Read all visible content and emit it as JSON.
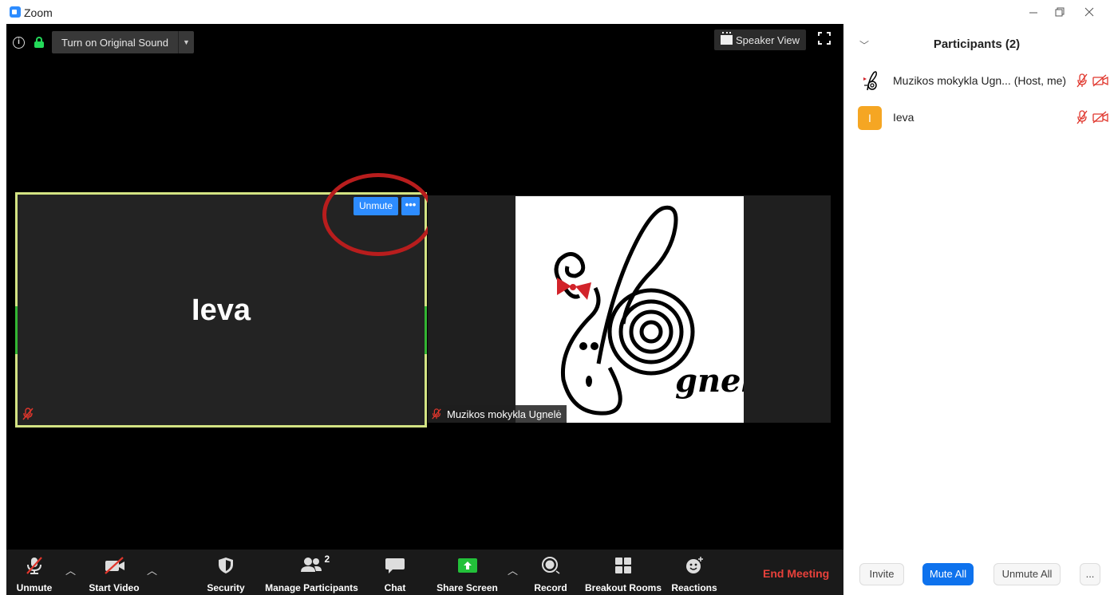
{
  "window": {
    "title": "Zoom",
    "controls": [
      "minimize-icon",
      "restore-icon",
      "close-icon"
    ]
  },
  "meeting": {
    "original_sound_label": "Turn on Original Sound",
    "speaker_view_label": "Speaker View",
    "tiles": [
      {
        "name": "Ieva",
        "muted": true,
        "active_speaker_border": "#d3e383"
      },
      {
        "name": "Muzikos mokykla Ugnelė",
        "muted": true
      }
    ],
    "tile_actions": {
      "unmute_label": "Unmute",
      "more_label": "•••"
    },
    "logo": {
      "text": "gnelė",
      "bow_color": "#d2232a"
    }
  },
  "toolbar": {
    "unmute": "Unmute",
    "start_video": "Start Video",
    "security": "Security",
    "manage_participants": "Manage Participants",
    "participant_count": "2",
    "chat": "Chat",
    "share_screen": "Share Screen",
    "record": "Record",
    "breakout_rooms": "Breakout Rooms",
    "reactions": "Reactions",
    "end_meeting": "End Meeting"
  },
  "participants_panel": {
    "title": "Participants (2)",
    "participants": [
      {
        "name": "Muzikos mokykla Ugn...",
        "role": "(Host, me)",
        "audio": "muted",
        "video": "off"
      },
      {
        "name": "Ieva",
        "initial": "I",
        "avatar_color": "#f5a623",
        "audio": "muted",
        "video": "off"
      }
    ],
    "buttons": {
      "invite": "Invite",
      "mute_all": "Mute All",
      "unmute_all": "Unmute All",
      "more": "..."
    }
  },
  "colors": {
    "accent": "#2d8cff",
    "end_meeting": "#e8413b",
    "muted_red": "#e0362c",
    "highlight_circle": "#b81d1d"
  }
}
